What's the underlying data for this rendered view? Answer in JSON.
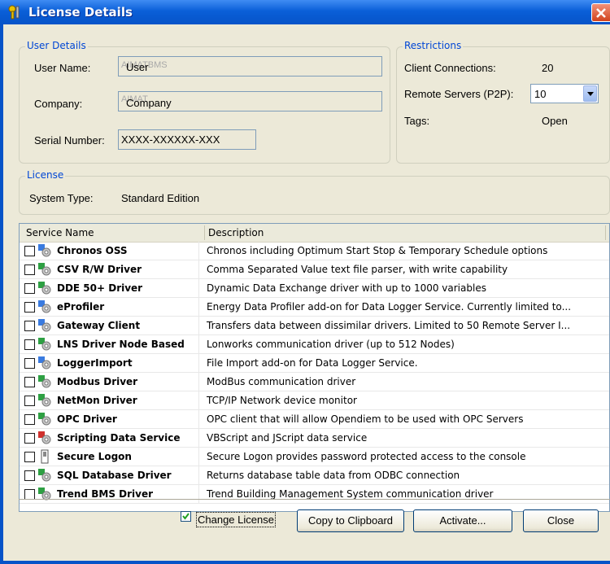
{
  "window": {
    "title": "License Details",
    "title_icon": "key-wrench-icon"
  },
  "user_details": {
    "legend": "User Details",
    "user_name_label": "User Name:",
    "user_name_ghost": "AIMATBMS",
    "user_name_value": "User",
    "company_label": "Company:",
    "company_ghost": "AIMAT",
    "company_value": "Company",
    "serial_label": "Serial Number:",
    "serial_value": "XXXX-XXXXXX-XXX"
  },
  "restrictions": {
    "legend": "Restrictions",
    "client_connections_label": "Client Connections:",
    "client_connections_value": "20",
    "remote_servers_label": "Remote Servers (P2P):",
    "remote_servers_value": "10",
    "tags_label": "Tags:",
    "tags_value": "Open"
  },
  "license": {
    "legend": "License",
    "system_type_label": "System Type:",
    "system_type_value": "Standard Edition"
  },
  "services": {
    "columns": [
      "Service Name",
      "Description"
    ],
    "rows": [
      {
        "name": "Chronos OSS",
        "desc": "Chronos including Optimum Start Stop & Temporary Schedule options",
        "icon": "service-blue-gear-icon"
      },
      {
        "name": "CSV R/W Driver",
        "desc": "Comma Separated Value text file parser, with write capability",
        "icon": "driver-green-gear-icon"
      },
      {
        "name": "DDE 50+ Driver",
        "desc": "Dynamic Data Exchange driver with up to 1000 variables",
        "icon": "driver-green-gear-icon"
      },
      {
        "name": "eProfiler",
        "desc": "Energy Data Profiler add-on for Data Logger Service. Currently limited to...",
        "icon": "service-blue-gear-icon"
      },
      {
        "name": "Gateway Client",
        "desc": "Transfers data between dissimilar drivers. Limited to 50 Remote Server I...",
        "icon": "service-blue-gear-icon"
      },
      {
        "name": "LNS Driver Node Based",
        "desc": "Lonworks communication driver (up to 512 Nodes)",
        "icon": "driver-green-gear-icon"
      },
      {
        "name": "LoggerImport",
        "desc": "File Import add-on for Data Logger Service.",
        "icon": "service-blue-gear-icon"
      },
      {
        "name": "Modbus Driver",
        "desc": "ModBus communication driver",
        "icon": "driver-green-gear-icon"
      },
      {
        "name": "NetMon Driver",
        "desc": "TCP/IP Network device monitor",
        "icon": "driver-green-gear-icon"
      },
      {
        "name": "OPC Driver",
        "desc": "OPC client that will allow Opendiem to be used with OPC Servers",
        "icon": "driver-green-gear-icon"
      },
      {
        "name": "Scripting Data Service",
        "desc": "VBScript and JScript data service",
        "icon": "script-red-gear-icon"
      },
      {
        "name": "Secure Logon",
        "desc": "Secure Logon provides password protected access to the console",
        "icon": "secure-logon-icon"
      },
      {
        "name": "SQL Database Driver",
        "desc": "Returns database table data from ODBC connection",
        "icon": "driver-green-gear-icon"
      },
      {
        "name": "Trend BMS Driver",
        "desc": "Trend Building Management System communication driver",
        "icon": "driver-green-gear-icon"
      }
    ]
  },
  "footer": {
    "change_license_label": "Change License",
    "copy_label": "Copy to Clipboard",
    "activate_label": "Activate...",
    "close_label": "Close"
  }
}
